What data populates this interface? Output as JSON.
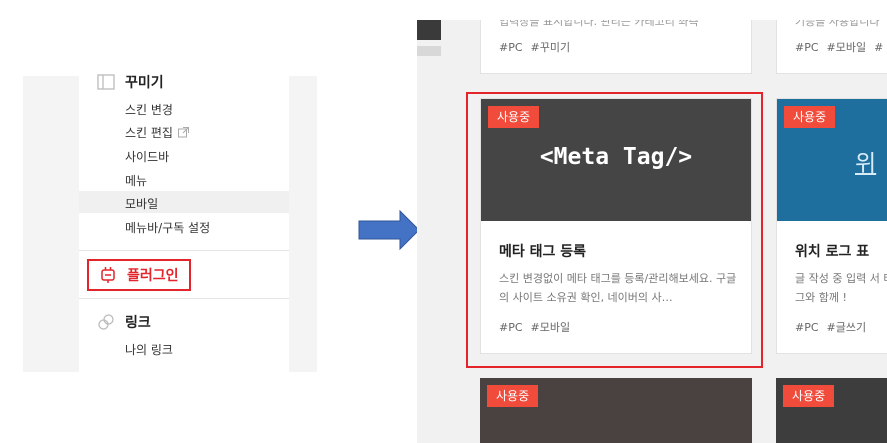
{
  "sidebar": {
    "decorate": {
      "label": "꾸미기",
      "icon": "layout-icon"
    },
    "decorate_items": [
      "스킨 변경",
      "스킨 편집",
      "사이드바",
      "메뉴",
      "모바일",
      "메뉴바/구독 설정"
    ],
    "plugin": {
      "label": "플러그인",
      "icon": "plug-icon"
    },
    "link": {
      "label": "링크",
      "icon": "link-icon"
    },
    "link_items": [
      "나의 링크"
    ]
  },
  "arrow": {
    "color": "#4472c4"
  },
  "cards": {
    "top_left": {
      "snippet": "입력창을 표시합니다. 관리는 카테고리 좌측",
      "tags": [
        "#PC",
        "#꾸미기"
      ]
    },
    "top_right": {
      "snippet": "기능을 사용합니다",
      "tags": [
        "#PC",
        "#모바일",
        "#"
      ]
    },
    "main": {
      "badge": "사용중",
      "thumb_title": "<Meta Tag/>",
      "title": "메타 태그 등록",
      "desc": "스킨 변경없이 메타 태그를 등록/관리해보세요. 구글의 사이트 소유권 확인, 네이버의 사…",
      "tags": [
        "#PC",
        "#모바일"
      ]
    },
    "right": {
      "badge": "사용중",
      "thumb_title": "위",
      "title": "위치 로그 표",
      "desc": "글 작성 중 입력 서 태그와 함께 !",
      "tags": [
        "#PC",
        "#글쓰기"
      ]
    },
    "bottom_left": {
      "badge": "사용중"
    },
    "bottom_right": {
      "badge": "사용중"
    }
  },
  "colors": {
    "accent_red": "#e3242b",
    "badge_red": "#f04b3b",
    "thumb_dark": "#454545",
    "thumb_blue": "#1e6f9e"
  }
}
